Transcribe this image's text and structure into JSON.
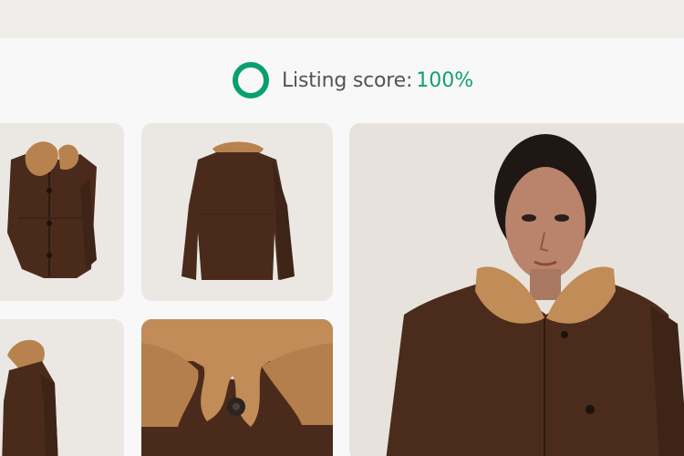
{
  "header": {
    "score_label": "Listing score:",
    "score_value": "100%",
    "score_color": "#11a06f"
  },
  "gallery": {
    "images": [
      {
        "name": "jacket-front-photo",
        "description": "brown shearling jacket front view"
      },
      {
        "name": "jacket-back-photo",
        "description": "brown shearling jacket back view"
      },
      {
        "name": "jacket-side-photo",
        "description": "brown shearling jacket side view"
      },
      {
        "name": "collar-detail-photo",
        "description": "shearling collar close-up"
      },
      {
        "name": "model-photo",
        "description": "model wearing jacket"
      }
    ]
  }
}
